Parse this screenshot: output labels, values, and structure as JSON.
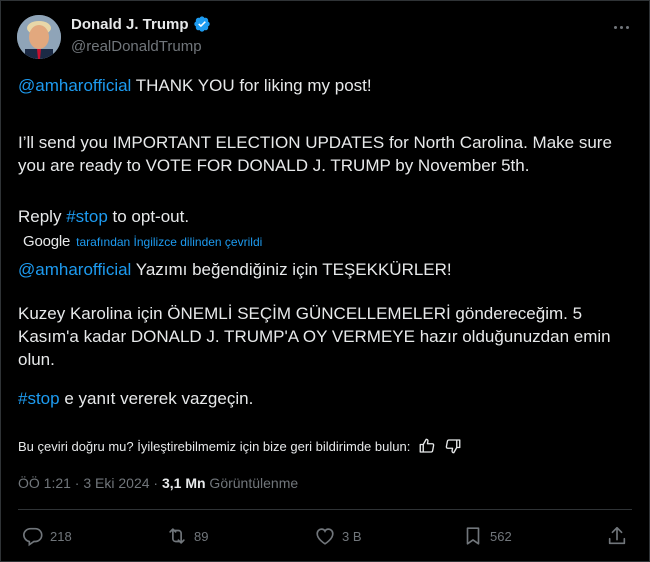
{
  "author": {
    "name": "Donald J. Trump",
    "handle": "@realDonaldTrump"
  },
  "post": {
    "line1_mention": "@amharofficial",
    "line1_rest": " THANK YOU for liking my post!",
    "para2": "I’ll send you IMPORTANT ELECTION UPDATES for North Carolina. Make sure you are ready to VOTE FOR DONALD J. TRUMP by November 5th.",
    "para3_prefix": "Reply ",
    "para3_hashtag": "#stop",
    "para3_suffix": " to opt-out."
  },
  "translation": {
    "provider": "Google",
    "label": "tarafından İngilizce dilinden çevrildi",
    "line1_mention": "@amharofficial",
    "line1_rest": " Yazımı beğendiğiniz için TEŞEKKÜRLER!",
    "para2": "Kuzey Karolina için ÖNEMLİ SEÇİM GÜNCELLEMELERİ göndereceğim. 5 Kasım'a kadar DONALD J. TRUMP'A OY VERMEYE hazır olduğunuzdan emin olun.",
    "para3_hashtag": "#stop",
    "para3_suffix": " e yanıt vererek vazgeçin.",
    "feedback_question": "Bu çeviri doğru mu? İyileştirebilmemiz için bize geri bildirimde bulun:"
  },
  "meta": {
    "time_date": "ÖÖ 1:21 · 3 Eki 2024 · ",
    "views_value": "3,1 Mn",
    "views_label": " Görüntülenme"
  },
  "actions": {
    "replies": "218",
    "reposts": "89",
    "likes": "3 B",
    "bookmarks": "562"
  },
  "colors": {
    "background": "#000000",
    "text": "#e7e9ea",
    "secondary": "#71767b",
    "accent": "#1d9bf0"
  }
}
